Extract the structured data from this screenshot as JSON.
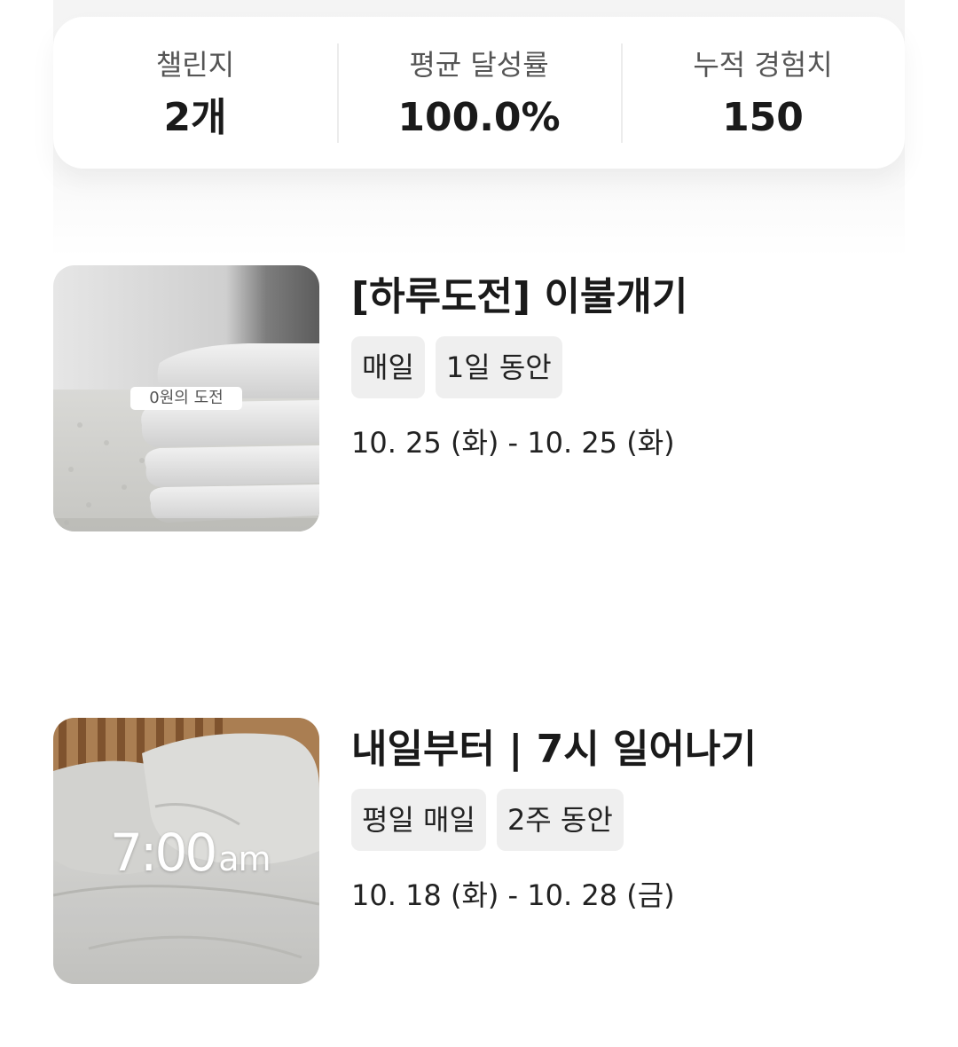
{
  "stats": {
    "items": [
      {
        "label": "챌린지",
        "value": "2개"
      },
      {
        "label": "평균 달성률",
        "value": "100.0%"
      },
      {
        "label": "누적 경험치",
        "value": "150"
      }
    ]
  },
  "challenges": [
    {
      "title": "[하루도전] 이불개기",
      "tags": [
        "매일",
        "1일 동안"
      ],
      "date_range": "10. 25 (화) - 10. 25 (화)",
      "thumbnail_badge": "0원의 도전"
    },
    {
      "title": "내일부터 | 7시 일어나기",
      "tags": [
        "평일 매일",
        "2주 동안"
      ],
      "date_range": "10. 18 (화) - 10. 28 (금)",
      "thumbnail_time": "7:00",
      "thumbnail_meridiem": "am"
    }
  ]
}
